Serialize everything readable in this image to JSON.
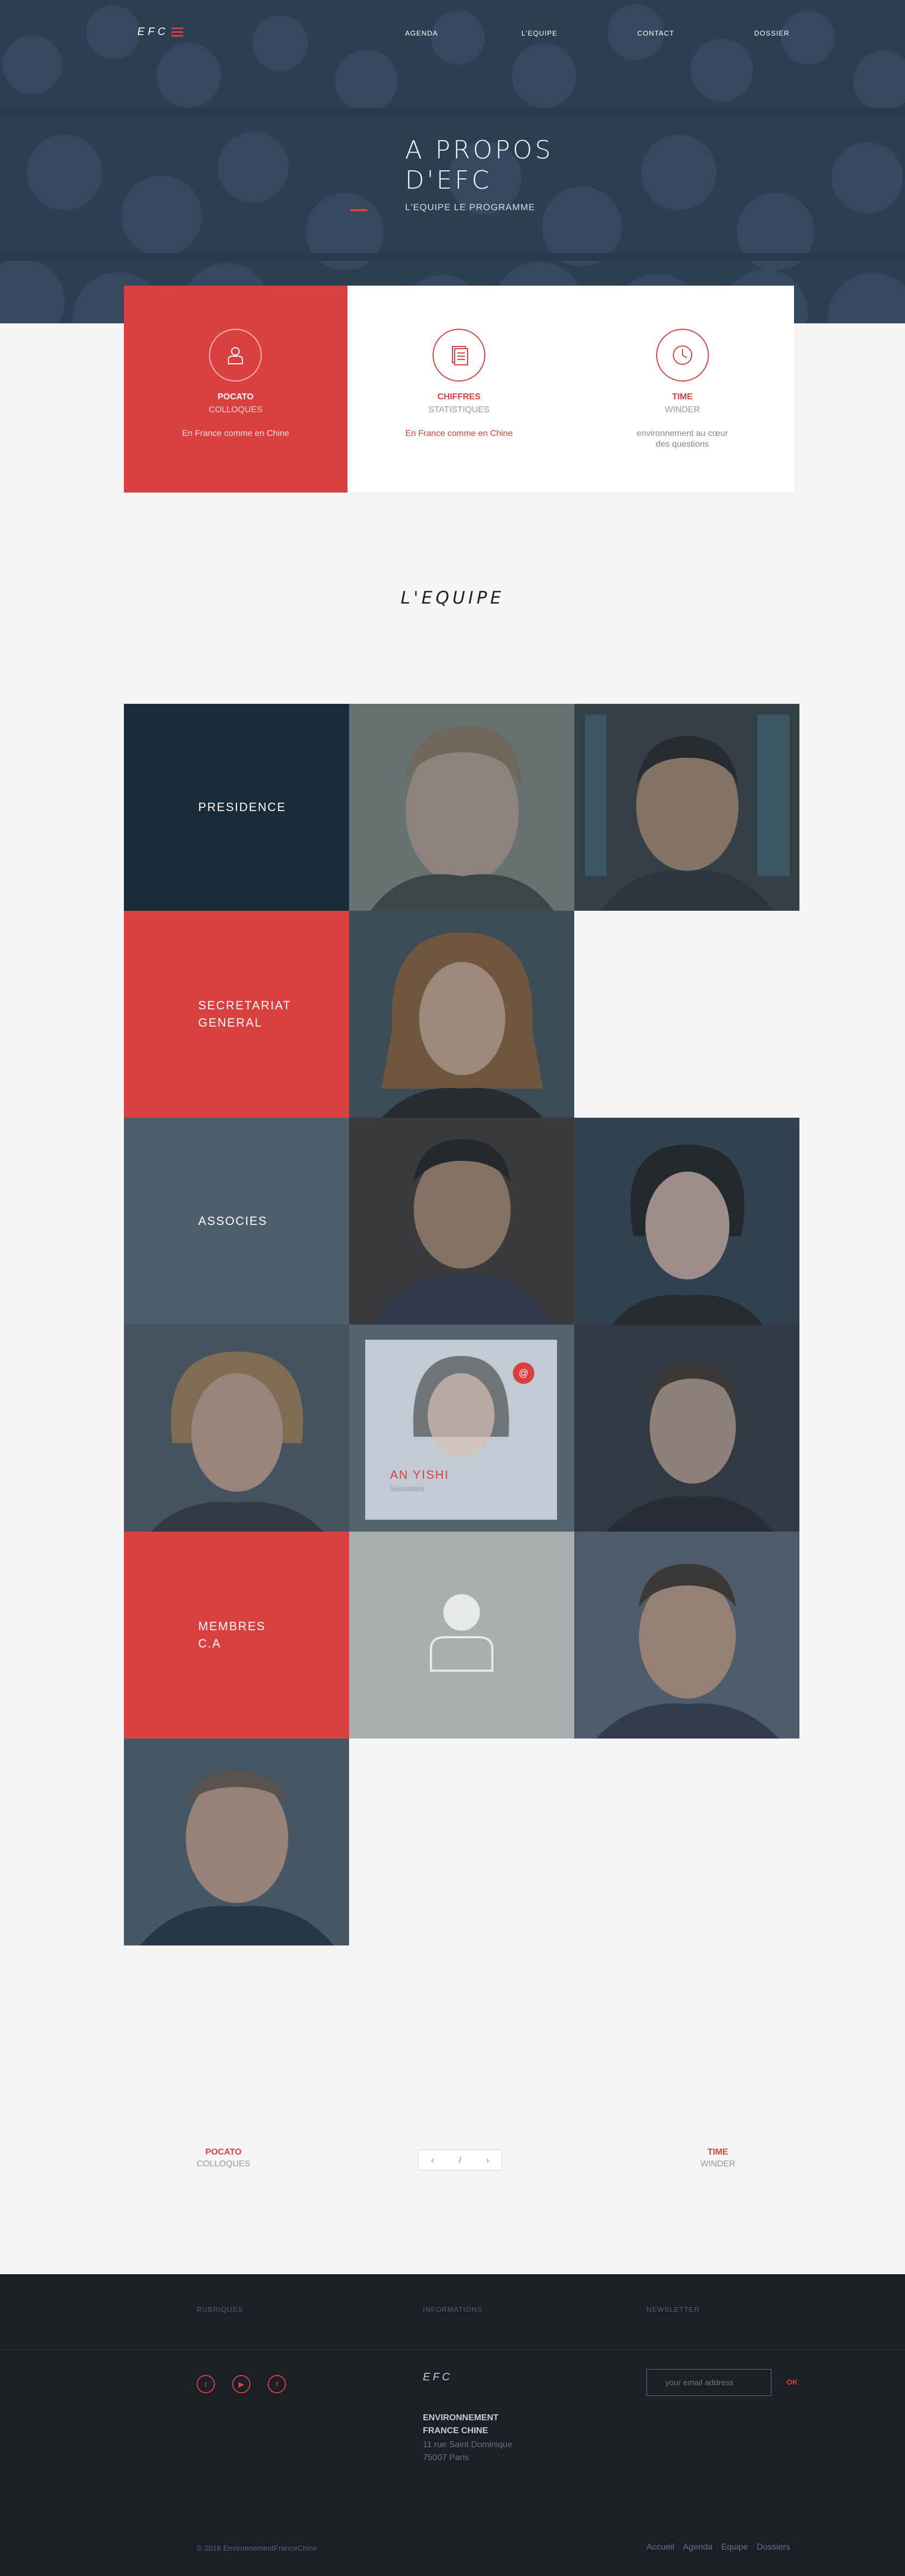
{
  "nav": {
    "logo": "EFC",
    "links": [
      "AGENDA",
      "L'EQUIPE",
      "CONTACT",
      "DOSSIER"
    ]
  },
  "hero": {
    "title_line1": "A PROPOS",
    "title_line2": "D'EFC",
    "subtitle": "L'EQUIPE LE PROGRAMME"
  },
  "features": [
    {
      "title": "POCATO",
      "sub": "COLLOQUES",
      "desc": "En France comme en Chine"
    },
    {
      "title": "CHIFFRES",
      "sub": "STATISTIQUES",
      "desc": "En France comme en Chine"
    },
    {
      "title": "TIME",
      "sub": "WINDER",
      "desc": "environnement au cœur des questions"
    }
  ],
  "team": {
    "title": "L'EQUIPE",
    "groups": {
      "presidence": "PRESIDENCE",
      "secretariat_l1": "SECRETARIAT",
      "secretariat_l2": "GENERAL",
      "associes": "ASSOCIES",
      "membres_l1": "MEMBRES",
      "membres_l2": "C.A"
    },
    "highlight": {
      "name": "AN YISHI",
      "role": "Secrétaire",
      "mail_icon": "@"
    }
  },
  "pager": {
    "left_title": "POCATO",
    "left_sub": "COLLOQUES",
    "prev": "‹",
    "sep": "/",
    "next": "›",
    "right_title": "TIME",
    "right_sub": "WINDER"
  },
  "footer": {
    "col1": "RUBRIQUES",
    "col2": "INFORMATIONS",
    "col3": "NEWSLETTER",
    "social": [
      "t",
      "▶",
      "f"
    ],
    "logo": "EFC",
    "org_l1": "ENVIRONNEMENT",
    "org_l2": "FRANCE CHINE",
    "addr_l1": "11 rue Saint Dominique",
    "addr_l2": "75007 Paris",
    "newsletter_placeholder": "your email address",
    "ok": "OK",
    "copyright": "© 2016 EnvironnementFranceChine",
    "links": [
      "Accueil",
      "Agenda",
      "Equipe",
      "Dossiers"
    ]
  },
  "colors": {
    "accent": "#d9403f",
    "dark": "#1b2a38",
    "slate": "#4d5e6a",
    "footer": "#1a1e25"
  }
}
